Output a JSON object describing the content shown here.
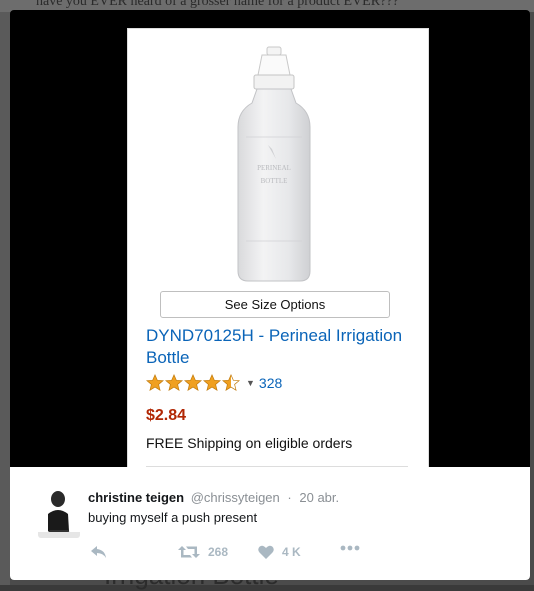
{
  "background": {
    "header_text": "have you EVER heard of a grosser name for a product EVER???",
    "bottom_text": "Irrigation Bottle"
  },
  "product": {
    "bottle_label": "PERINEAL BOTTLE",
    "size_button": "See Size Options",
    "title": "DYND70125H - Perineal Irrigation Bottle",
    "rating": 4.5,
    "rating_count": "328",
    "price": "$2.84",
    "shipping": "FREE Shipping on eligible orders",
    "icons": {
      "rating_caret": "caret-down-icon",
      "star": "star-icon"
    }
  },
  "tweet": {
    "author_name": "christine teigen",
    "handle": "@chrissyteigen",
    "separator": "·",
    "date": "20 abr.",
    "text": "buying myself a push present",
    "actions": {
      "reply_icon": "reply-icon",
      "retweet_icon": "retweet-icon",
      "retweet_count": "268",
      "like_icon": "heart-icon",
      "like_count": "4 K",
      "more_icon": "more-icon"
    }
  },
  "colors": {
    "link_blue": "#0a64b8",
    "price_red": "#b12704",
    "star_gold": "#f0a020",
    "action_gray": "#aab8c2"
  }
}
